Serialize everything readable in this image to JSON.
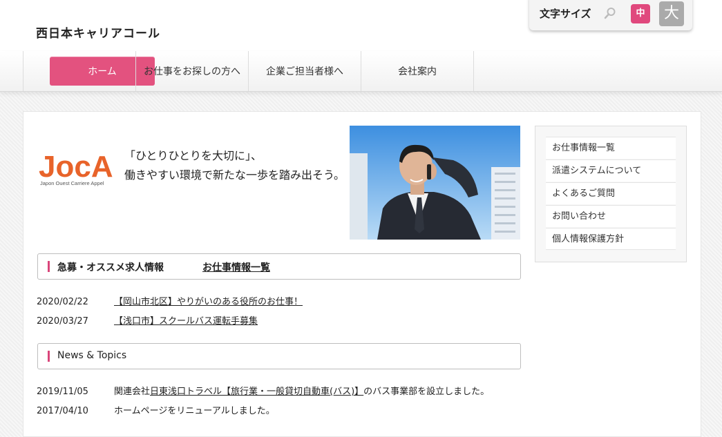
{
  "site": {
    "title": "西日本キャリアコール"
  },
  "font_size": {
    "label": "文字サイズ",
    "medium": "中",
    "large": "大"
  },
  "nav": {
    "home": "ホーム",
    "items": [
      "お仕事をお探しの方へ",
      "企業ご担当者様へ",
      "会社案内"
    ]
  },
  "banner": {
    "logo_text": "JocA",
    "logo_sub": "Japon Ouest Carriere Appel",
    "line1": "「ひとりひとりを大切に」、",
    "line2": "働きやすい環境で新たな一歩を踏み出そう。"
  },
  "jobs": {
    "title": "急募・オススメ求人情報",
    "link": "お仕事情報一覧",
    "items": [
      {
        "date": "2020/02/22",
        "text": "【岡山市北区】やりがいのある役所のお仕事！"
      },
      {
        "date": "2020/03/27",
        "text": "【浅口市】スクールバス運転手募集"
      }
    ]
  },
  "news": {
    "title": "News & Topics",
    "items": [
      {
        "date": "2019/11/05",
        "prefix": "関連会社",
        "link": "日東浅口トラベル【旅行業・一般貸切自動車(バス)】",
        "suffix": "のバス事業部を設立しました。"
      },
      {
        "date": "2017/04/10",
        "text": "ホームページをリニューアルしました。"
      }
    ]
  },
  "sidebar": {
    "items": [
      "お仕事情報一覧",
      "派遣システムについて",
      "よくあるご質問",
      "お問い合わせ",
      "個人情報保護方針"
    ]
  },
  "colors": {
    "accent": "#e3527f",
    "logo_orange": "#e8632a"
  }
}
